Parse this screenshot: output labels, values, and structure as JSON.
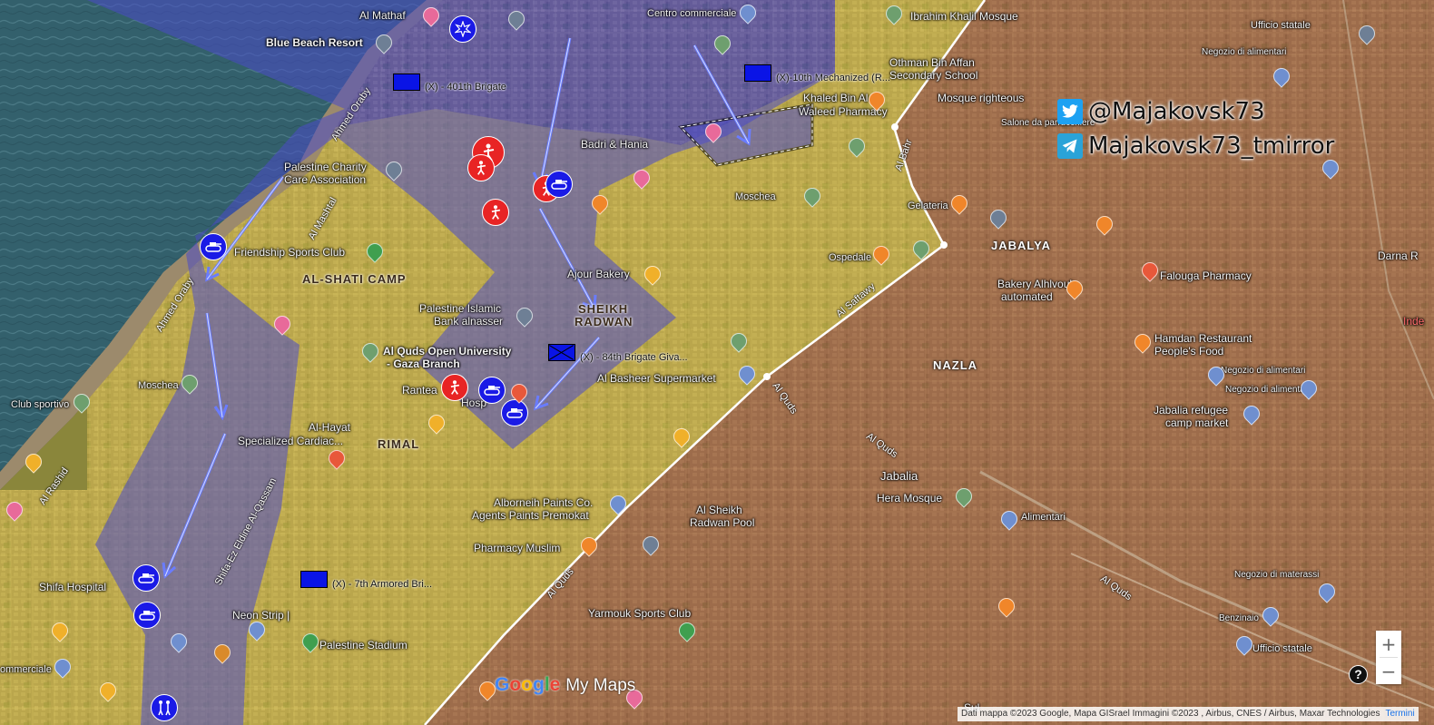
{
  "map": {
    "brand": {
      "google": "Google",
      "mymaps": "My Maps"
    },
    "attribution": "Dati mappa ©2023 Google, Mapa GISrael Immagini ©2023 , Airbus, CNES / Airbus, Maxar Technologies",
    "terms": "Termini",
    "zoom_in": "+",
    "zoom_out": "−",
    "help": "?"
  },
  "handles": {
    "twitter": "@Majakovsk73",
    "telegram": "Majakovsk73_tmirror"
  },
  "units": {
    "u401": "(X) - 401th Brigate",
    "u10": "(X)-10th Mechanized (R...",
    "u84": "(X) - 84th Brigate Giva...",
    "u7": "(X) - 7th Armored Bri..."
  },
  "areas": {
    "shati": "AL-SHATI CAMP",
    "sheikh": "SHEIKH",
    "radwan": "RADWAN",
    "rimal": "RIMAL",
    "jabalya": "JABALYA",
    "nazla": "NAZLA",
    "jabalia": "Jabalia"
  },
  "places": {
    "al_mathaf": "Al Mathaf",
    "blue_beach": "Blue Beach Resort",
    "centro": "Centro commerciale",
    "ibrahim": "Ibrahim Khalil Mosque",
    "othman1": "Othman Bin Affan",
    "othman2": "Secondary School",
    "khaled1": "Khaled Bin Al",
    "khaled2": "Waleed Pharmacy",
    "mosque_righteous": "Mosque righteous",
    "salone": "Salone da parrucchiere",
    "badri": "Badri & Hania",
    "palestine_charity1": "Palestine Charity",
    "palestine_charity2": "Care Association",
    "friendship": "Friendship Sports Club",
    "moschea1": "Moschea",
    "gelateria": "Gelateria",
    "ospedale": "Ospedale",
    "ajour": "Ajour Bakery",
    "islamic1": "Palestine Islamic",
    "islamic2": "Bank alnasser",
    "alquds_univ1": "Al Quds Open University",
    "alquds_univ2": "- Gaza Branch",
    "moschea2": "Moschea",
    "club_sportivo": "Club sportivo",
    "basheer": "Al Basheer Supermarket",
    "rantea": "Rantea",
    "hosp": "Hosp",
    "alhayat1": "Al-Hayat",
    "alhayat2": "Specialized Cardiac...",
    "alborneih1": "Alborneih Paints Co.",
    "alborneih2": "Agents Paints Premokat",
    "pharmacy_muslim": "Pharmacy Muslim",
    "sheikh_pool1": "Al Sheikh",
    "sheikh_pool2": "Radwan Pool",
    "hera": "Hera Mosque",
    "alimentari1": "Alimentari",
    "yarmouk": "Yarmouk Sports Club",
    "shifa": "Shifa Hospital",
    "neon": "Neon Strip |",
    "palestine_stadium": "Palestine Stadium",
    "commerciale": "ommerciale",
    "bakery_alhlvouh1": "Bakery Alhlvouh",
    "bakery_alhlvouh2": "automated",
    "falouga": "Falouga Pharmacy",
    "hamdan1": "Hamdan Restaurant",
    "hamdan2": "People's Food",
    "negozio_alimentari1": "Negozio di alimentari",
    "negozio_alimentari2": "Negozio di alimentari",
    "negozio_alimentari3": "Negozio di alimentari",
    "jabalia_market1": "Jabalia refugee",
    "jabalia_market2": "camp market",
    "darna": "Darna R",
    "inde": "Inde",
    "negozio_materassi": "Negozio di materassi",
    "benzinaio": "Benzinaio",
    "ufficio1": "Ufficio statale",
    "ufficio2": "Ufficio statale",
    "sul": "Sul"
  },
  "roads": {
    "ahmed_oraby1": "Ahmed Oraby",
    "ahmed_oraby2": "Ahmed Oraby",
    "al_rashid": "Al Rashid",
    "al_mashtal": "Al Mashtal",
    "shifa_ezeldine": "Shifa-Ez Eldine Al-Qassam",
    "al_saftawy": "Al Saftawy",
    "al_quds1": "Al Quds",
    "al_quds2": "Al Quds",
    "al_quds3": "Al Quds",
    "al_quds4": "Al Quds",
    "al_bahr": "Al Bahr",
    "gamal": "Gamal Abd El Nasser",
    "naser": "Al Nasr",
    "al_falouja": "Al Falouja",
    "ghal": "Al Toufah"
  }
}
